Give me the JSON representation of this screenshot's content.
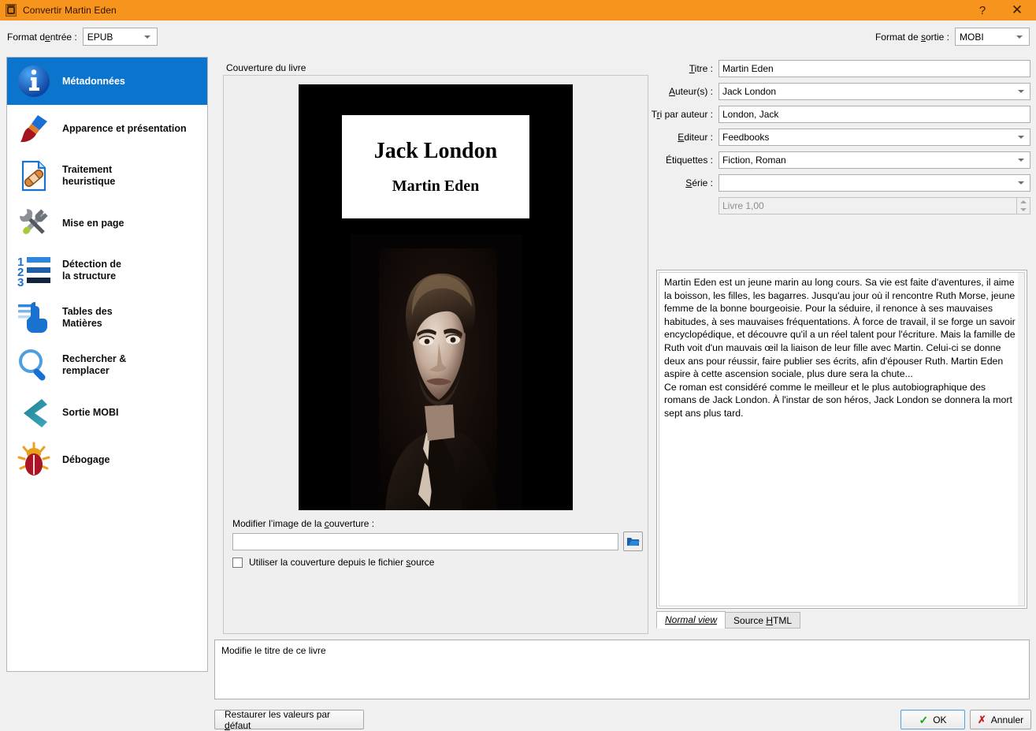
{
  "window": {
    "title": "Convertir Martin Eden",
    "icon": "convert-icon",
    "help_label": "?",
    "close_label": "✕",
    "accent_color": "#f7941e"
  },
  "toolbar": {
    "input_format_label_pre": "Format d",
    "input_format_label": "Format d’entrée :",
    "input_format_value": "EPUB",
    "output_format_label": "Format de sortie :",
    "output_format_value": "MOBI"
  },
  "sidebar": {
    "items": [
      {
        "label": "Métadonnées",
        "icon": "info-icon",
        "selected": true
      },
      {
        "label": "Apparence et présentation",
        "icon": "paintbrush-icon",
        "selected": false
      },
      {
        "label": "Traitement\nheuristique",
        "icon": "document-bandage-icon",
        "selected": false
      },
      {
        "label": "Mise en page",
        "icon": "wrench-screwdriver-icon",
        "selected": false
      },
      {
        "label": "Détection de\nla structure",
        "icon": "numbered-list-icon",
        "selected": false
      },
      {
        "label": "Tables des\nMatières",
        "icon": "toc-hand-icon",
        "selected": false
      },
      {
        "label": "Rechercher &\nremplacer",
        "icon": "magnifier-icon",
        "selected": false
      },
      {
        "label": "Sortie MOBI",
        "icon": "chevron-left-icon",
        "selected": false
      },
      {
        "label": "Débogage",
        "icon": "bug-icon",
        "selected": false
      }
    ],
    "selected_bg": "#0b74cc"
  },
  "cover": {
    "group_title": "Couverture du livre",
    "image_author": "Jack London",
    "image_title": "Martin Eden",
    "image_alt": "portrait-photo-jack-london",
    "edit_label": "Modifier l’image de la couverture :",
    "path_value": "",
    "browse_icon": "open-folder-icon",
    "use_source_checkbox_label": "Utiliser la couverture depuis le fichier source",
    "use_source_checked": false
  },
  "metadata": {
    "fields": [
      {
        "label": "Titre :",
        "value": "Martin Eden",
        "combo": false,
        "disabled": false
      },
      {
        "label": "Auteur(s) :",
        "value": "Jack London",
        "combo": true,
        "disabled": false
      },
      {
        "label": "Tri par auteur :",
        "value": "London, Jack",
        "combo": false,
        "disabled": false
      },
      {
        "label": "Editeur :",
        "value": "Feedbooks",
        "combo": true,
        "disabled": false
      },
      {
        "label": "Étiquettes :",
        "value": "Fiction, Roman",
        "combo": true,
        "disabled": false
      },
      {
        "label": "Série :",
        "value": "",
        "combo": true,
        "disabled": false
      }
    ],
    "series_index": {
      "label": "",
      "value": "Livre 1,00",
      "disabled": true
    }
  },
  "comments": {
    "paragraphs": [
      "Martin Eden est un jeune marin au long cours. Sa vie est faite d'aventures, il aime la boisson, les filles, les bagarres. Jusqu'au jour où il rencontre Ruth Morse, jeune femme de la bonne bourgeoisie. Pour la séduire, il renonce à ses mauvaises habitudes, à ses mauvaises fréquentations. À force de travail, il se forge un savoir encyclopédique, et découvre qu'il a un réel talent pour l'écriture. Mais la famille de Ruth voit d'un mauvais œil la liaison de leur fille avec Martin. Celui-ci se donne deux ans pour réussir, faire publier ses écrits, afin d'épouser Ruth. Martin Eden aspire à cette ascension sociale, plus dure sera la chute...",
      "Ce roman est considéré comme le meilleur et le plus autobiographique des romans de Jack London. À l'instar de son héros, Jack London se donnera la mort sept ans plus tard."
    ],
    "tabs": [
      {
        "label": "Normal view",
        "active": true
      },
      {
        "label": "Source HTML",
        "active": false
      }
    ]
  },
  "help": {
    "text": "Modifie le titre de ce livre"
  },
  "buttons": {
    "restore": "Restaurer les valeurs par défaut",
    "ok": "OK",
    "cancel": "Annuler",
    "ok_icon": "check-icon",
    "cancel_icon": "x-icon"
  }
}
